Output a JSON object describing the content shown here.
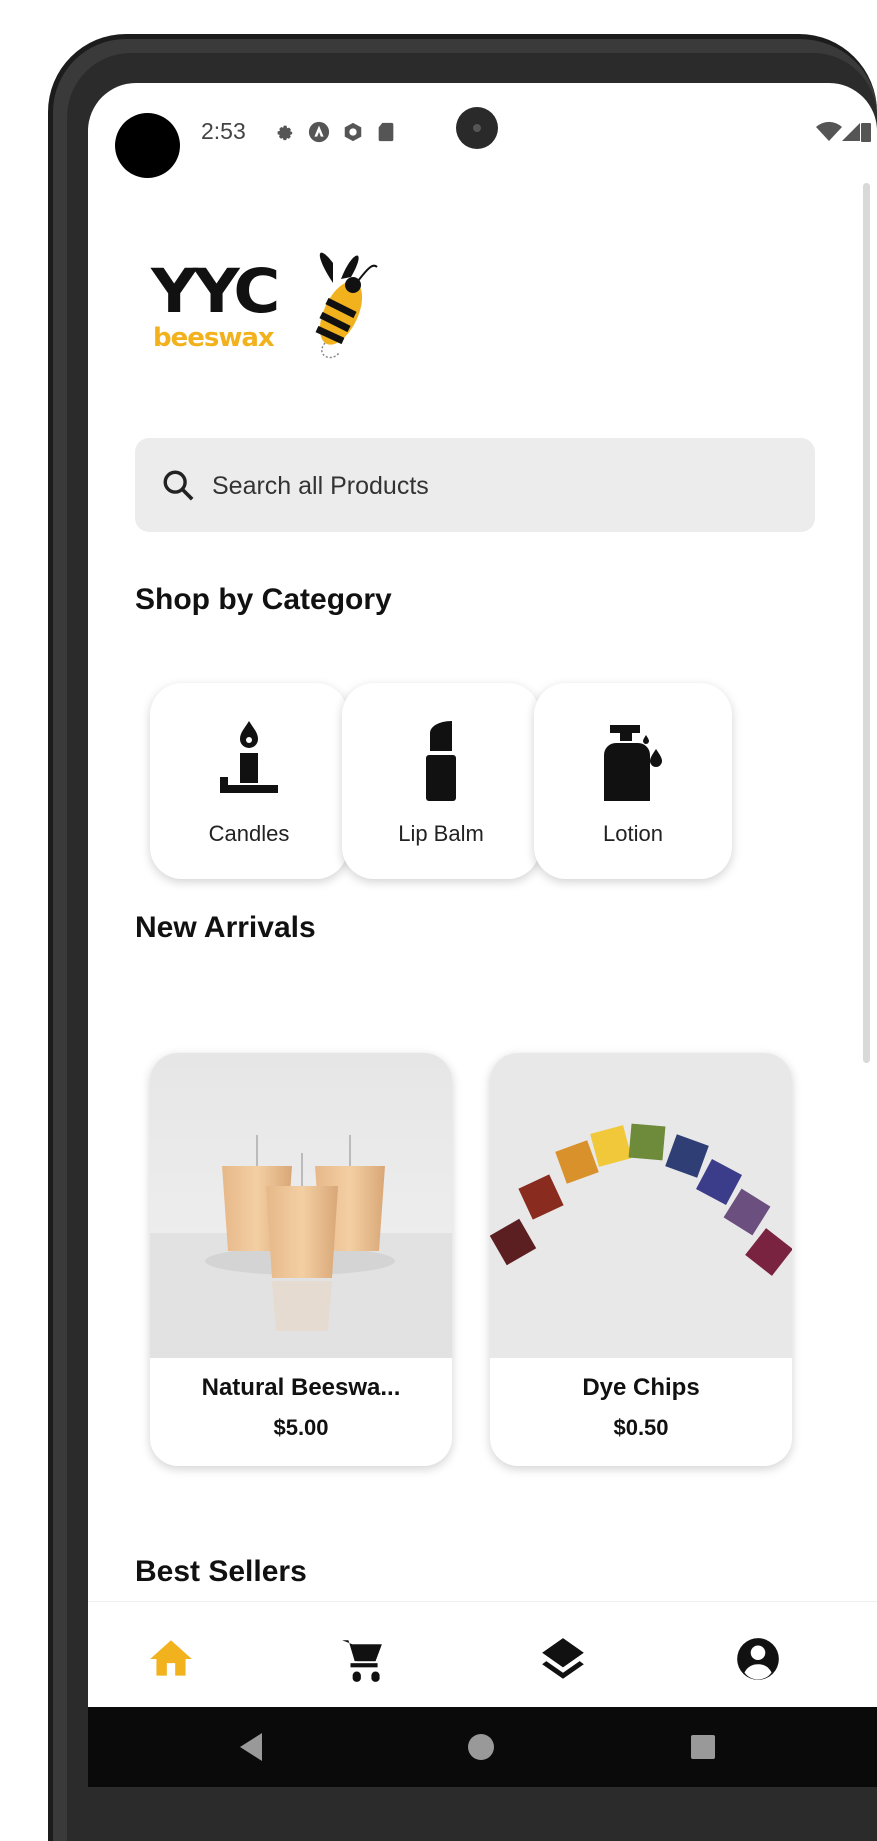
{
  "status_bar": {
    "time": "2:53"
  },
  "brand": {
    "logo_main": "YYC",
    "logo_sub": "beeswax",
    "accent_color": "#f2b21e"
  },
  "search": {
    "placeholder": "Search all Products"
  },
  "sections": {
    "categories_title": "Shop by Category",
    "new_arrivals_title": "New Arrivals",
    "best_sellers_title": "Best Sellers"
  },
  "categories": [
    {
      "label": "Candles",
      "icon": "candle-icon"
    },
    {
      "label": "Lip Balm",
      "icon": "lip-balm-icon"
    },
    {
      "label": "Lotion",
      "icon": "lotion-icon"
    }
  ],
  "new_arrivals": [
    {
      "name": "Natural Beeswa...",
      "price": "$5.00"
    },
    {
      "name": "Dye Chips",
      "price": "$0.50"
    }
  ],
  "bottom_nav": [
    {
      "icon": "home-icon",
      "active": true
    },
    {
      "icon": "cart-icon",
      "active": false
    },
    {
      "icon": "layers-icon",
      "active": false
    },
    {
      "icon": "account-icon",
      "active": false
    }
  ]
}
